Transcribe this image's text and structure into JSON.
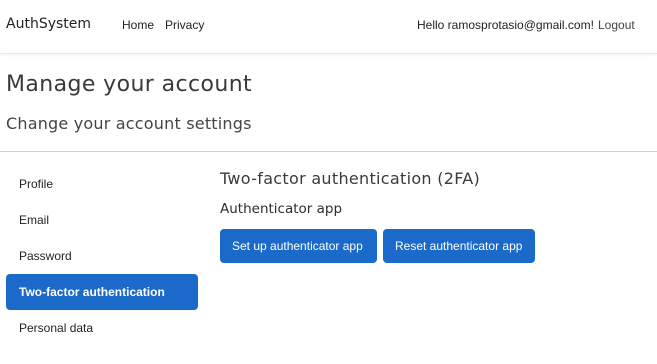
{
  "navbar": {
    "brand": "AuthSystem",
    "links": {
      "home": "Home",
      "privacy": "Privacy"
    },
    "greeting": "Hello ramosprotasio@gmail.com!",
    "logout": "Logout"
  },
  "page": {
    "title": "Manage your account",
    "subtitle": "Change your account settings"
  },
  "sidebar": {
    "items": [
      {
        "label": "Profile",
        "active": false
      },
      {
        "label": "Email",
        "active": false
      },
      {
        "label": "Password",
        "active": false
      },
      {
        "label": "Two-factor authentication",
        "active": true
      },
      {
        "label": "Personal data",
        "active": false
      }
    ]
  },
  "main": {
    "heading": "Two-factor authentication (2FA)",
    "subheading": "Authenticator app",
    "buttons": {
      "setup": "Set up authenticator app",
      "reset": "Reset authenticator app"
    }
  },
  "colors": {
    "accent": "#1b6ac9",
    "text": "#333333",
    "background": "#ffffff"
  }
}
